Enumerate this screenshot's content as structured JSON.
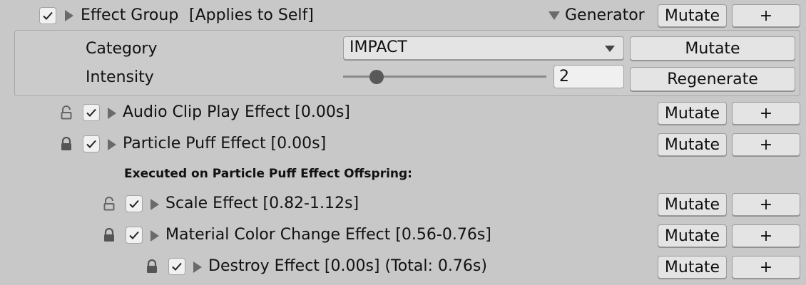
{
  "header": {
    "title": "Effect Group",
    "applies": "[Applies to Self]",
    "generator_label": "Generator",
    "mutate_label": "Mutate",
    "add_label": "+"
  },
  "generator": {
    "category_label": "Category",
    "category_value": "IMPACT",
    "mutate_label": "Mutate",
    "intensity_label": "Intensity",
    "intensity_value": "2",
    "intensity_fraction": 0.14,
    "regenerate_label": "Regenerate"
  },
  "effects": [
    {
      "label": "Audio Clip Play Effect [0.00s]",
      "locked": false,
      "checked": true,
      "mutate": "Mutate",
      "add": "+"
    },
    {
      "label": "Particle Puff Effect [0.00s]",
      "locked": true,
      "checked": true,
      "mutate": "Mutate",
      "add": "+"
    }
  ],
  "offspring_header": "Executed on Particle Puff Effect Offspring:",
  "offspring": [
    {
      "label": "Scale Effect [0.82-1.12s]",
      "locked": false,
      "checked": true,
      "mutate": "Mutate",
      "add": "+"
    },
    {
      "label": "Material Color Change Effect [0.56-0.76s]",
      "locked": true,
      "checked": true,
      "mutate": "Mutate",
      "add": "+"
    },
    {
      "label": "Destroy Effect [0.00s] (Total: 0.76s)",
      "locked": true,
      "checked": true,
      "mutate": "Mutate",
      "add": "+"
    }
  ]
}
